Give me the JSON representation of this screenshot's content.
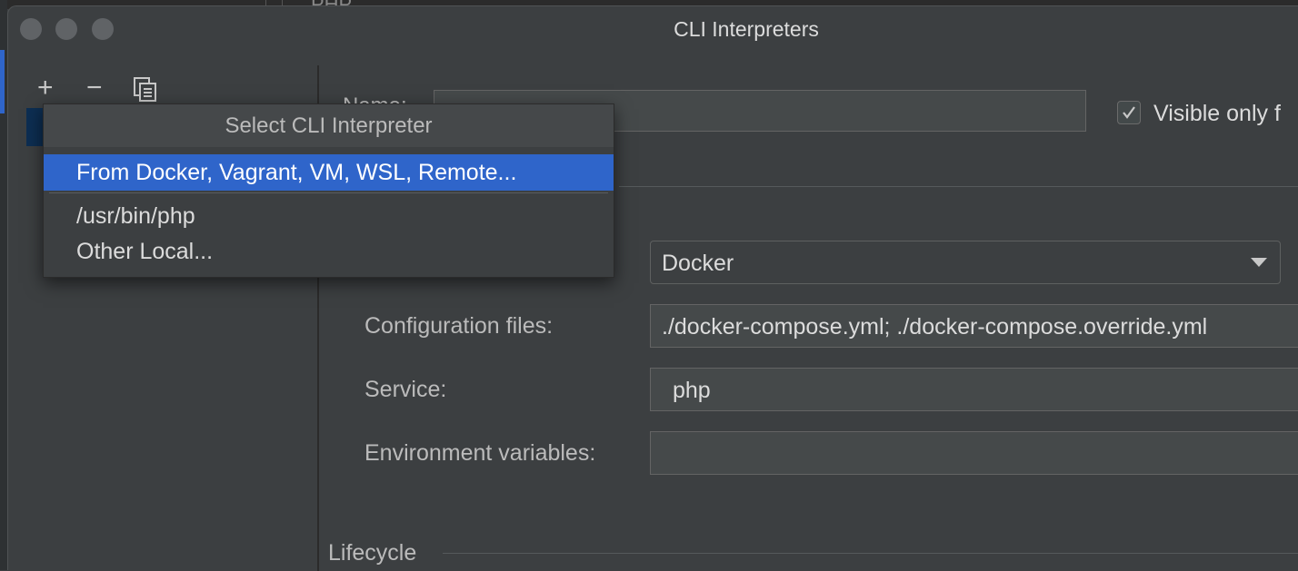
{
  "window": {
    "title": "CLI Interpreters",
    "behind_title": "PHP"
  },
  "toolbar": {
    "add_icon": "plus-icon",
    "add_label": "+",
    "remove_icon": "minus-icon",
    "remove_label": "−",
    "copy_icon": "copy-icon"
  },
  "popup": {
    "header": "Select CLI Interpreter",
    "items": [
      {
        "label": "From Docker, Vagrant, VM, WSL, Remote...",
        "selected": true
      },
      {
        "label": "/usr/bin/php",
        "selected": false
      },
      {
        "label": "Other Local...",
        "selected": false
      }
    ]
  },
  "form": {
    "name_label": "Name:",
    "name_value": "",
    "visible_only_label": "Visible only f",
    "visible_only_checked": true,
    "server_value": "Docker",
    "config_files_label": "Configuration files:",
    "config_files_value": "./docker-compose.yml; ./docker-compose.override.yml",
    "service_label": "Service:",
    "service_value": "php",
    "env_vars_label": "Environment variables:",
    "env_vars_value": "",
    "lifecycle_label": "Lifecycle"
  },
  "colors": {
    "background": "#3c3f41",
    "selection": "#2f65ca",
    "text": "#bbbbbb"
  }
}
